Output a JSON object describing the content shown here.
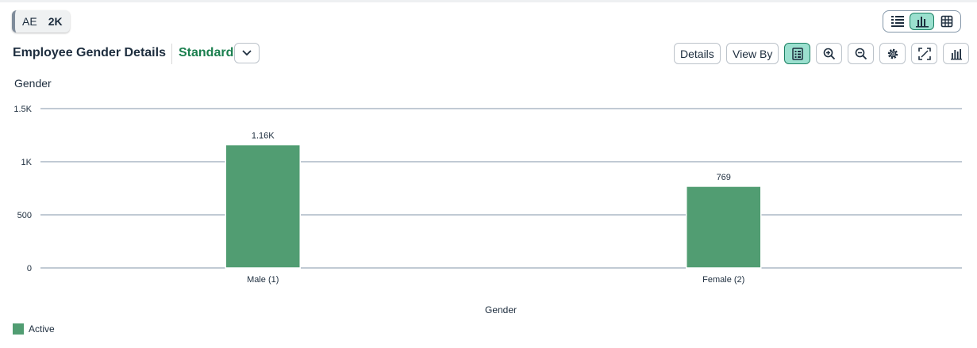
{
  "tokens": {
    "first": "AE",
    "second": "2K"
  },
  "header": {
    "title": "Employee Gender Details",
    "variant": "Standard"
  },
  "toolbar": {
    "details_label": "Details",
    "view_by_label": "View By"
  },
  "colors": {
    "accent": "#1a7f4e",
    "bar": "#519d72",
    "active_bg": "#9be0cf"
  },
  "chart_data": {
    "type": "bar",
    "title": "Gender",
    "xlabel": "Gender",
    "ylabel": "",
    "categories": [
      "Male (1)",
      "Female (2)"
    ],
    "series": [
      {
        "name": "Active",
        "values": [
          1160,
          769
        ],
        "labels": [
          "1.16K",
          "769"
        ]
      }
    ],
    "yticks": [
      0,
      500,
      1000,
      1500
    ],
    "ytick_labels": [
      "0",
      "500",
      "1K",
      "1.5K"
    ],
    "ylim": [
      0,
      1500
    ],
    "grid": true,
    "legend": "bottom-left"
  }
}
